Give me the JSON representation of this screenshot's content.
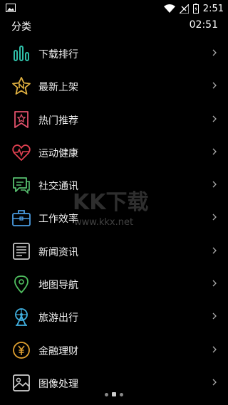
{
  "status_bar": {
    "time": "2:51",
    "icons": [
      "image-icon",
      "wifi-icon",
      "signal-icon",
      "battery-icon"
    ]
  },
  "header": {
    "title": "分类",
    "clock": "02:51"
  },
  "categories": [
    {
      "label": "下载排行",
      "icon": "bar-chart-icon",
      "color": "#2fbfa8"
    },
    {
      "label": "最新上架",
      "icon": "new-star-icon",
      "color": "#e0b040"
    },
    {
      "label": "热门推荐",
      "icon": "hot-bookmark-icon",
      "color": "#e0506a"
    },
    {
      "label": "运动健康",
      "icon": "heart-pulse-icon",
      "color": "#e04050"
    },
    {
      "label": "社交通讯",
      "icon": "chat-bubble-icon",
      "color": "#58c070"
    },
    {
      "label": "工作效率",
      "icon": "briefcase-icon",
      "color": "#4a9be0"
    },
    {
      "label": "新闻资讯",
      "icon": "newspaper-icon",
      "color": "#c8c8c8"
    },
    {
      "label": "地图导航",
      "icon": "map-pin-icon",
      "color": "#50c060"
    },
    {
      "label": "旅游出行",
      "icon": "ferris-wheel-icon",
      "color": "#40b0e0"
    },
    {
      "label": "金融理财",
      "icon": "yuan-coin-icon",
      "color": "#e0a030"
    },
    {
      "label": "图像处理",
      "icon": "image-icon",
      "color": "#d0d0d0"
    }
  ],
  "watermark": {
    "brand": "KK下载",
    "url": "www.kkx.net"
  },
  "pager": {
    "count": 3,
    "active": 1
  }
}
